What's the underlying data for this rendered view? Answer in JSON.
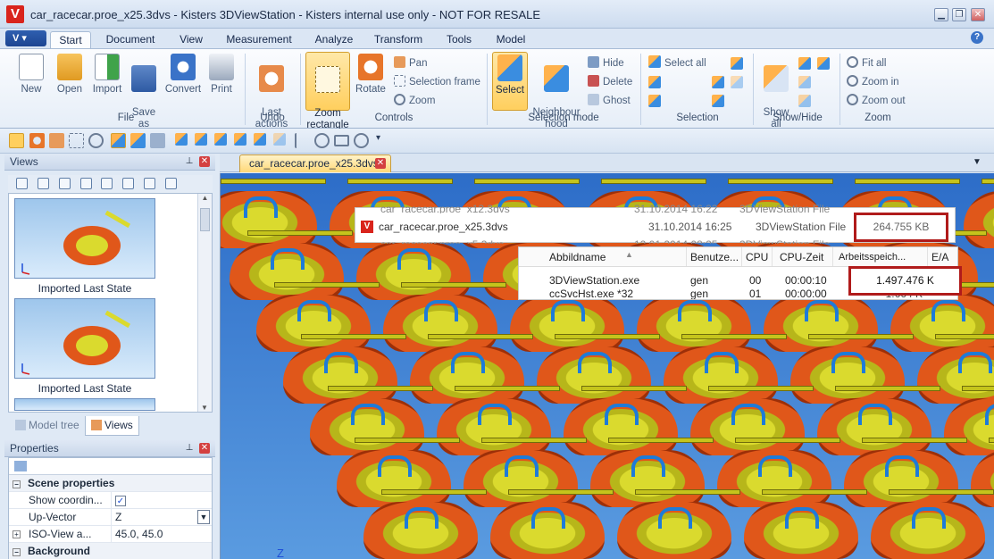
{
  "window": {
    "title": "car_racecar.proe_x25.3dvs - Kisters 3DViewStation - Kisters internal use only - NOT FOR RESALE",
    "app_logo": "V",
    "app_menu": "V"
  },
  "tabs": [
    "Start",
    "Document",
    "View",
    "Measurement",
    "Analyze",
    "Transform",
    "Tools",
    "Model"
  ],
  "ribbon": {
    "file": {
      "label": "File",
      "new": "New",
      "open": "Open",
      "import": "Import",
      "save_as": "Save\nas",
      "convert": "Convert",
      "print": "Print"
    },
    "undo": {
      "label": "Undo",
      "last_actions": "Last\nactions"
    },
    "controls": {
      "label": "Controls",
      "zoom_rectangle": "Zoom\nrectangle",
      "rotate": "Rotate",
      "pan": "Pan",
      "selection_frame": "Selection frame",
      "zoom": "Zoom"
    },
    "selection_mode": {
      "label": "Selection mode",
      "select": "Select",
      "neighbourhood": "Neighbour\nhood"
    },
    "hide_group": {
      "hide": "Hide",
      "delete": "Delete",
      "ghost": "Ghost"
    },
    "selection": {
      "label": "Selection",
      "select_all": "Select all"
    },
    "show_hide": {
      "label": "Show/Hide",
      "show_all": "Show\nall"
    },
    "zoom_group": {
      "label": "Zoom",
      "fit_all": "Fit all",
      "zoom_in": "Zoom in",
      "zoom_out": "Zoom out"
    }
  },
  "views_panel": {
    "title": "Views",
    "items": [
      {
        "label": "Imported Last State"
      },
      {
        "label": "Imported Last State"
      }
    ],
    "tab_model_tree": "Model tree",
    "tab_views": "Views"
  },
  "properties_panel": {
    "title": "Properties",
    "section_scene": "Scene properties",
    "rows": [
      {
        "name": "Show coordin...",
        "value": "✓"
      },
      {
        "name": "Up-Vector",
        "value": "Z"
      },
      {
        "name": "ISO-View a...",
        "value": "45.0, 45.0"
      }
    ],
    "section_background": "Background"
  },
  "document": {
    "tab": "car_racecar.proe_x25.3dvs",
    "axis_label": "Z"
  },
  "explorer_overlay": {
    "rows": [
      {
        "name": "car_racecar.proe_x12.3dvs",
        "date": "31.10.2014 16:22",
        "type": "3DViewStation File"
      },
      {
        "name": "car_racecar.proe_x25.3dvs",
        "date": "31.10.2014 16:25",
        "type": "3DViewStation File",
        "size": "264.755 KB"
      },
      {
        "name": "car_racecar.proe_x5.3dvs",
        "date": "12.01.2014 08:25",
        "type": "3DViewStation File"
      }
    ]
  },
  "taskmanager_overlay": {
    "headers": [
      "Abbildname",
      "Benutze...",
      "CPU",
      "CPU-Zeit",
      "Arbeitsspeich...",
      "E/A"
    ],
    "rows": [
      {
        "name": "3DViewStation.exe",
        "user": "gen",
        "cpu": "00",
        "time": "00:00:10",
        "mem": "1.497.476 K"
      },
      {
        "name": "ccSvcHst.exe *32",
        "user": "gen",
        "cpu": "01",
        "time": "00:00:00",
        "mem": "1.664 K"
      }
    ]
  },
  "colors": {
    "accent": "#ffcf5e",
    "brand": "#d9241c",
    "ribbon": "#e6eef8",
    "viewport": "#2d6dc8",
    "highlight_box": "#b01b1b"
  }
}
